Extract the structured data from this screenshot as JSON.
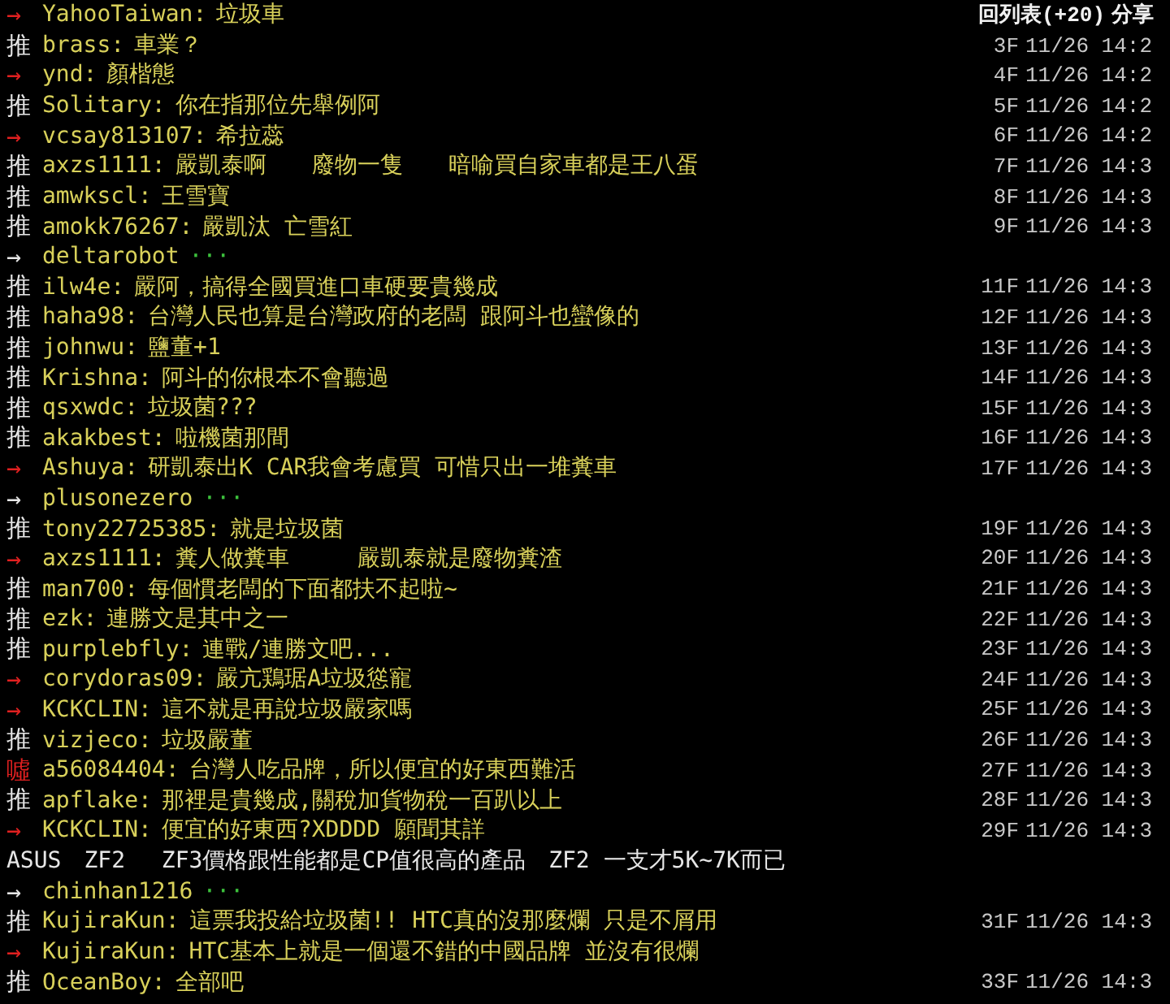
{
  "header": {
    "back": "回列表(+20)",
    "share": "分享"
  },
  "rows": [
    {
      "kind": "arrow",
      "tag": "→",
      "user": "YahooTaiwan:",
      "text": "垃圾車"
    },
    {
      "kind": "push",
      "tag": "推",
      "user": "brass:",
      "text": "車業？",
      "floor": "3F",
      "time": "11/26 14:2"
    },
    {
      "kind": "arrow",
      "tag": "→",
      "user": "ynd:",
      "text": "顏楷態",
      "floor": "4F",
      "time": "11/26 14:2"
    },
    {
      "kind": "push",
      "tag": "推",
      "user": "Solitary:",
      "text": "你在指那位先舉例阿",
      "floor": "5F",
      "time": "11/26 14:2"
    },
    {
      "kind": "arrow",
      "tag": "→",
      "user": "vcsay813107:",
      "text": "希拉蕊",
      "floor": "6F",
      "time": "11/26 14:2"
    },
    {
      "kind": "push",
      "tag": "推",
      "user": "axzs1111:",
      "text": "嚴凱泰啊　　廢物一隻　　暗喻買自家車都是王八蛋",
      "floor": "7F",
      "time": "11/26 14:3"
    },
    {
      "kind": "push",
      "tag": "推",
      "user": "amwkscl:",
      "text": "王雪寶",
      "floor": "8F",
      "time": "11/26 14:3"
    },
    {
      "kind": "push",
      "tag": "推",
      "user": "amokk76267:",
      "text": "嚴凱汰 亡雪紅",
      "floor": "9F",
      "time": "11/26 14:3"
    },
    {
      "kind": "fold",
      "tag": "→",
      "user": "deltarobot",
      "text": "···"
    },
    {
      "kind": "push",
      "tag": "推",
      "user": "ilw4e:",
      "text": "嚴阿，搞得全國買進口車硬要貴幾成",
      "floor": "11F",
      "time": "11/26 14:3"
    },
    {
      "kind": "push",
      "tag": "推",
      "user": "haha98:",
      "text": "台灣人民也算是台灣政府的老闆 跟阿斗也蠻像的",
      "floor": "12F",
      "time": "11/26 14:3"
    },
    {
      "kind": "push",
      "tag": "推",
      "user": "johnwu:",
      "text": "鹽董+1",
      "floor": "13F",
      "time": "11/26 14:3"
    },
    {
      "kind": "push",
      "tag": "推",
      "user": "Krishna:",
      "text": "阿斗的你根本不會聽過",
      "floor": "14F",
      "time": "11/26 14:3"
    },
    {
      "kind": "push",
      "tag": "推",
      "user": "qsxwdc:",
      "text": "垃圾菌???",
      "floor": "15F",
      "time": "11/26 14:3"
    },
    {
      "kind": "push",
      "tag": "推",
      "user": "akakbest:",
      "text": "啦機菌那間",
      "floor": "16F",
      "time": "11/26 14:3"
    },
    {
      "kind": "arrow",
      "tag": "→",
      "user": "Ashuya:",
      "text": "研凱泰出K CAR我會考慮買 可惜只出一堆糞車",
      "floor": "17F",
      "time": "11/26 14:3"
    },
    {
      "kind": "fold",
      "tag": "→",
      "user": "plusonezero",
      "text": "···"
    },
    {
      "kind": "push",
      "tag": "推",
      "user": "tony22725385:",
      "text": "就是垃圾菌",
      "floor": "19F",
      "time": "11/26 14:3"
    },
    {
      "kind": "arrow",
      "tag": "→",
      "user": "axzs1111:",
      "text": "糞人做糞車　　　嚴凱泰就是廢物糞渣",
      "floor": "20F",
      "time": "11/26 14:3"
    },
    {
      "kind": "push",
      "tag": "推",
      "user": "man700:",
      "text": "每個慣老闆的下面都扶不起啦~",
      "floor": "21F",
      "time": "11/26 14:3"
    },
    {
      "kind": "push",
      "tag": "推",
      "user": "ezk:",
      "text": "連勝文是其中之一",
      "floor": "22F",
      "time": "11/26 14:3"
    },
    {
      "kind": "push",
      "tag": "推",
      "user": "purplebfly:",
      "text": "連戰/連勝文吧...",
      "floor": "23F",
      "time": "11/26 14:3"
    },
    {
      "kind": "arrow",
      "tag": "→",
      "user": "corydoras09:",
      "text": "嚴亢鶏琚A垃圾慫寵",
      "floor": "24F",
      "time": "11/26 14:3"
    },
    {
      "kind": "arrow",
      "tag": "→",
      "user": "KCKCLIN:",
      "text": "這不就是再說垃圾嚴家嗎",
      "floor": "25F",
      "time": "11/26 14:3"
    },
    {
      "kind": "push",
      "tag": "推",
      "user": "vizjeco:",
      "text": "垃圾嚴董",
      "floor": "26F",
      "time": "11/26 14:3"
    },
    {
      "kind": "boo",
      "tag": "噓",
      "user": "a56084404:",
      "text": "台灣人吃品牌，所以便宜的好東西難活",
      "floor": "27F",
      "time": "11/26 14:3"
    },
    {
      "kind": "push",
      "tag": "推",
      "user": "apflake:",
      "text": "那裡是貴幾成,關稅加貨物稅一百趴以上",
      "floor": "28F",
      "time": "11/26 14:3"
    },
    {
      "kind": "arrow",
      "tag": "→",
      "user": "KCKCLIN:",
      "text": "便宜的好東西?XDDDD 願聞其詳",
      "floor": "29F",
      "time": "11/26 14:3"
    },
    {
      "kind": "plain",
      "text": "ASUS　ZF2　 ZF3價格跟性能都是CP值很高的產品　ZF2 一支才5K~7K而已"
    },
    {
      "kind": "fold",
      "tag": "→",
      "user": "chinhan1216",
      "text": "···"
    },
    {
      "kind": "push",
      "tag": "推",
      "user": "KujiraKun:",
      "text": "這票我投給垃圾菌!! HTC真的沒那麼爛 只是不屑用",
      "floor": "31F",
      "time": "11/26 14:3"
    },
    {
      "kind": "arrow",
      "tag": "→",
      "user": "KujiraKun:",
      "text": "HTC基本上就是一個還不錯的中國品牌 並沒有很爛"
    },
    {
      "kind": "push",
      "tag": "推",
      "user": "OceanBoy:",
      "text": "全部吧",
      "floor": "33F",
      "time": "11/26 14:3"
    }
  ]
}
